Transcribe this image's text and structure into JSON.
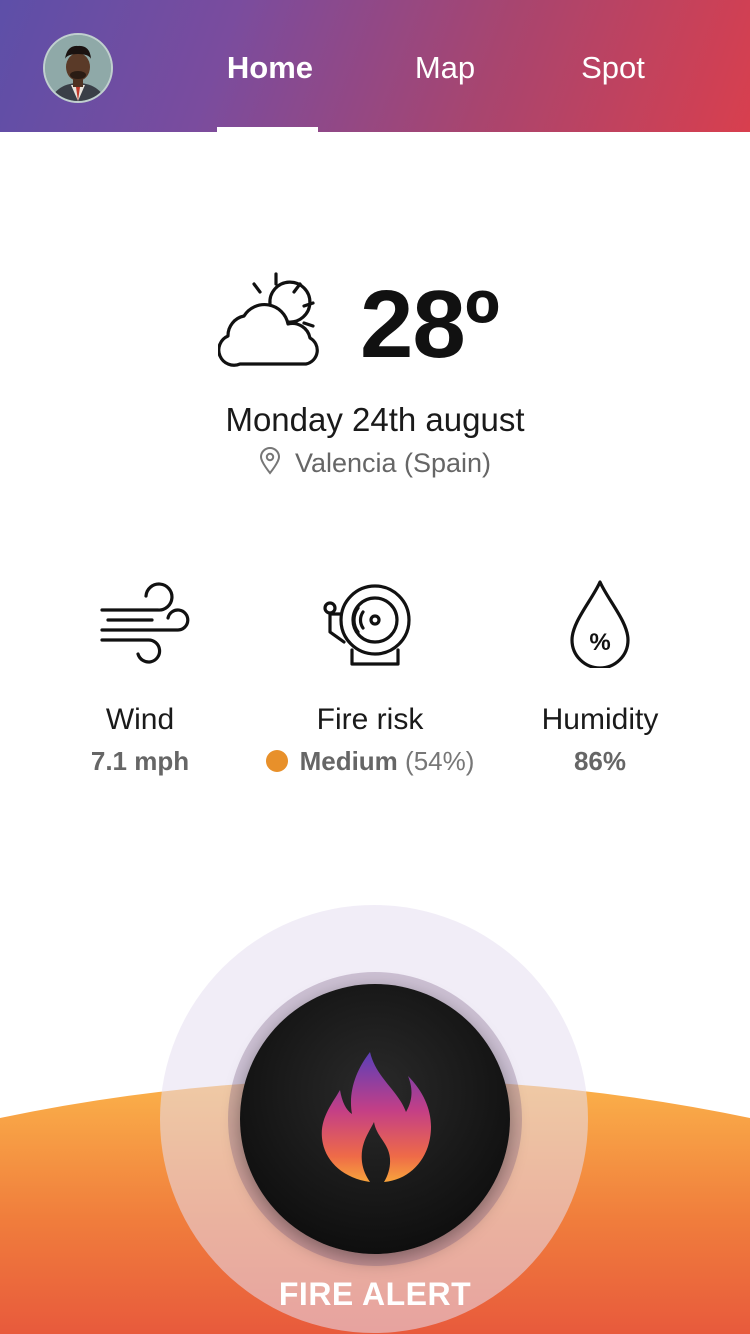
{
  "header": {
    "avatar_icon": "user-avatar",
    "tabs": [
      {
        "label": "Home",
        "active": true
      },
      {
        "label": "Map",
        "active": false
      },
      {
        "label": "Spot",
        "active": false
      }
    ],
    "gradient_start": "#5d4fa8",
    "gradient_end": "#d83f4e"
  },
  "weather": {
    "icon": "partly-cloudy-icon",
    "temperature": "28º",
    "date": "Monday 24th august",
    "location_icon": "location-pin-icon",
    "location": "Valencia (Spain)"
  },
  "stats": {
    "wind": {
      "icon": "wind-icon",
      "label": "Wind",
      "value": "7.1 mph"
    },
    "fire_risk": {
      "icon": "alarm-bell-icon",
      "label": "Fire risk",
      "level": "Medium",
      "percent": "(54%)",
      "level_color": "#e8902a"
    },
    "humidity": {
      "icon": "humidity-drop-icon",
      "label": "Humidity",
      "value": "86%"
    }
  },
  "alert": {
    "icon": "flame-icon",
    "label": "FIRE ALERT",
    "wave_colors": [
      "#fbb24a",
      "#f07d3c",
      "#e85a3c"
    ]
  }
}
